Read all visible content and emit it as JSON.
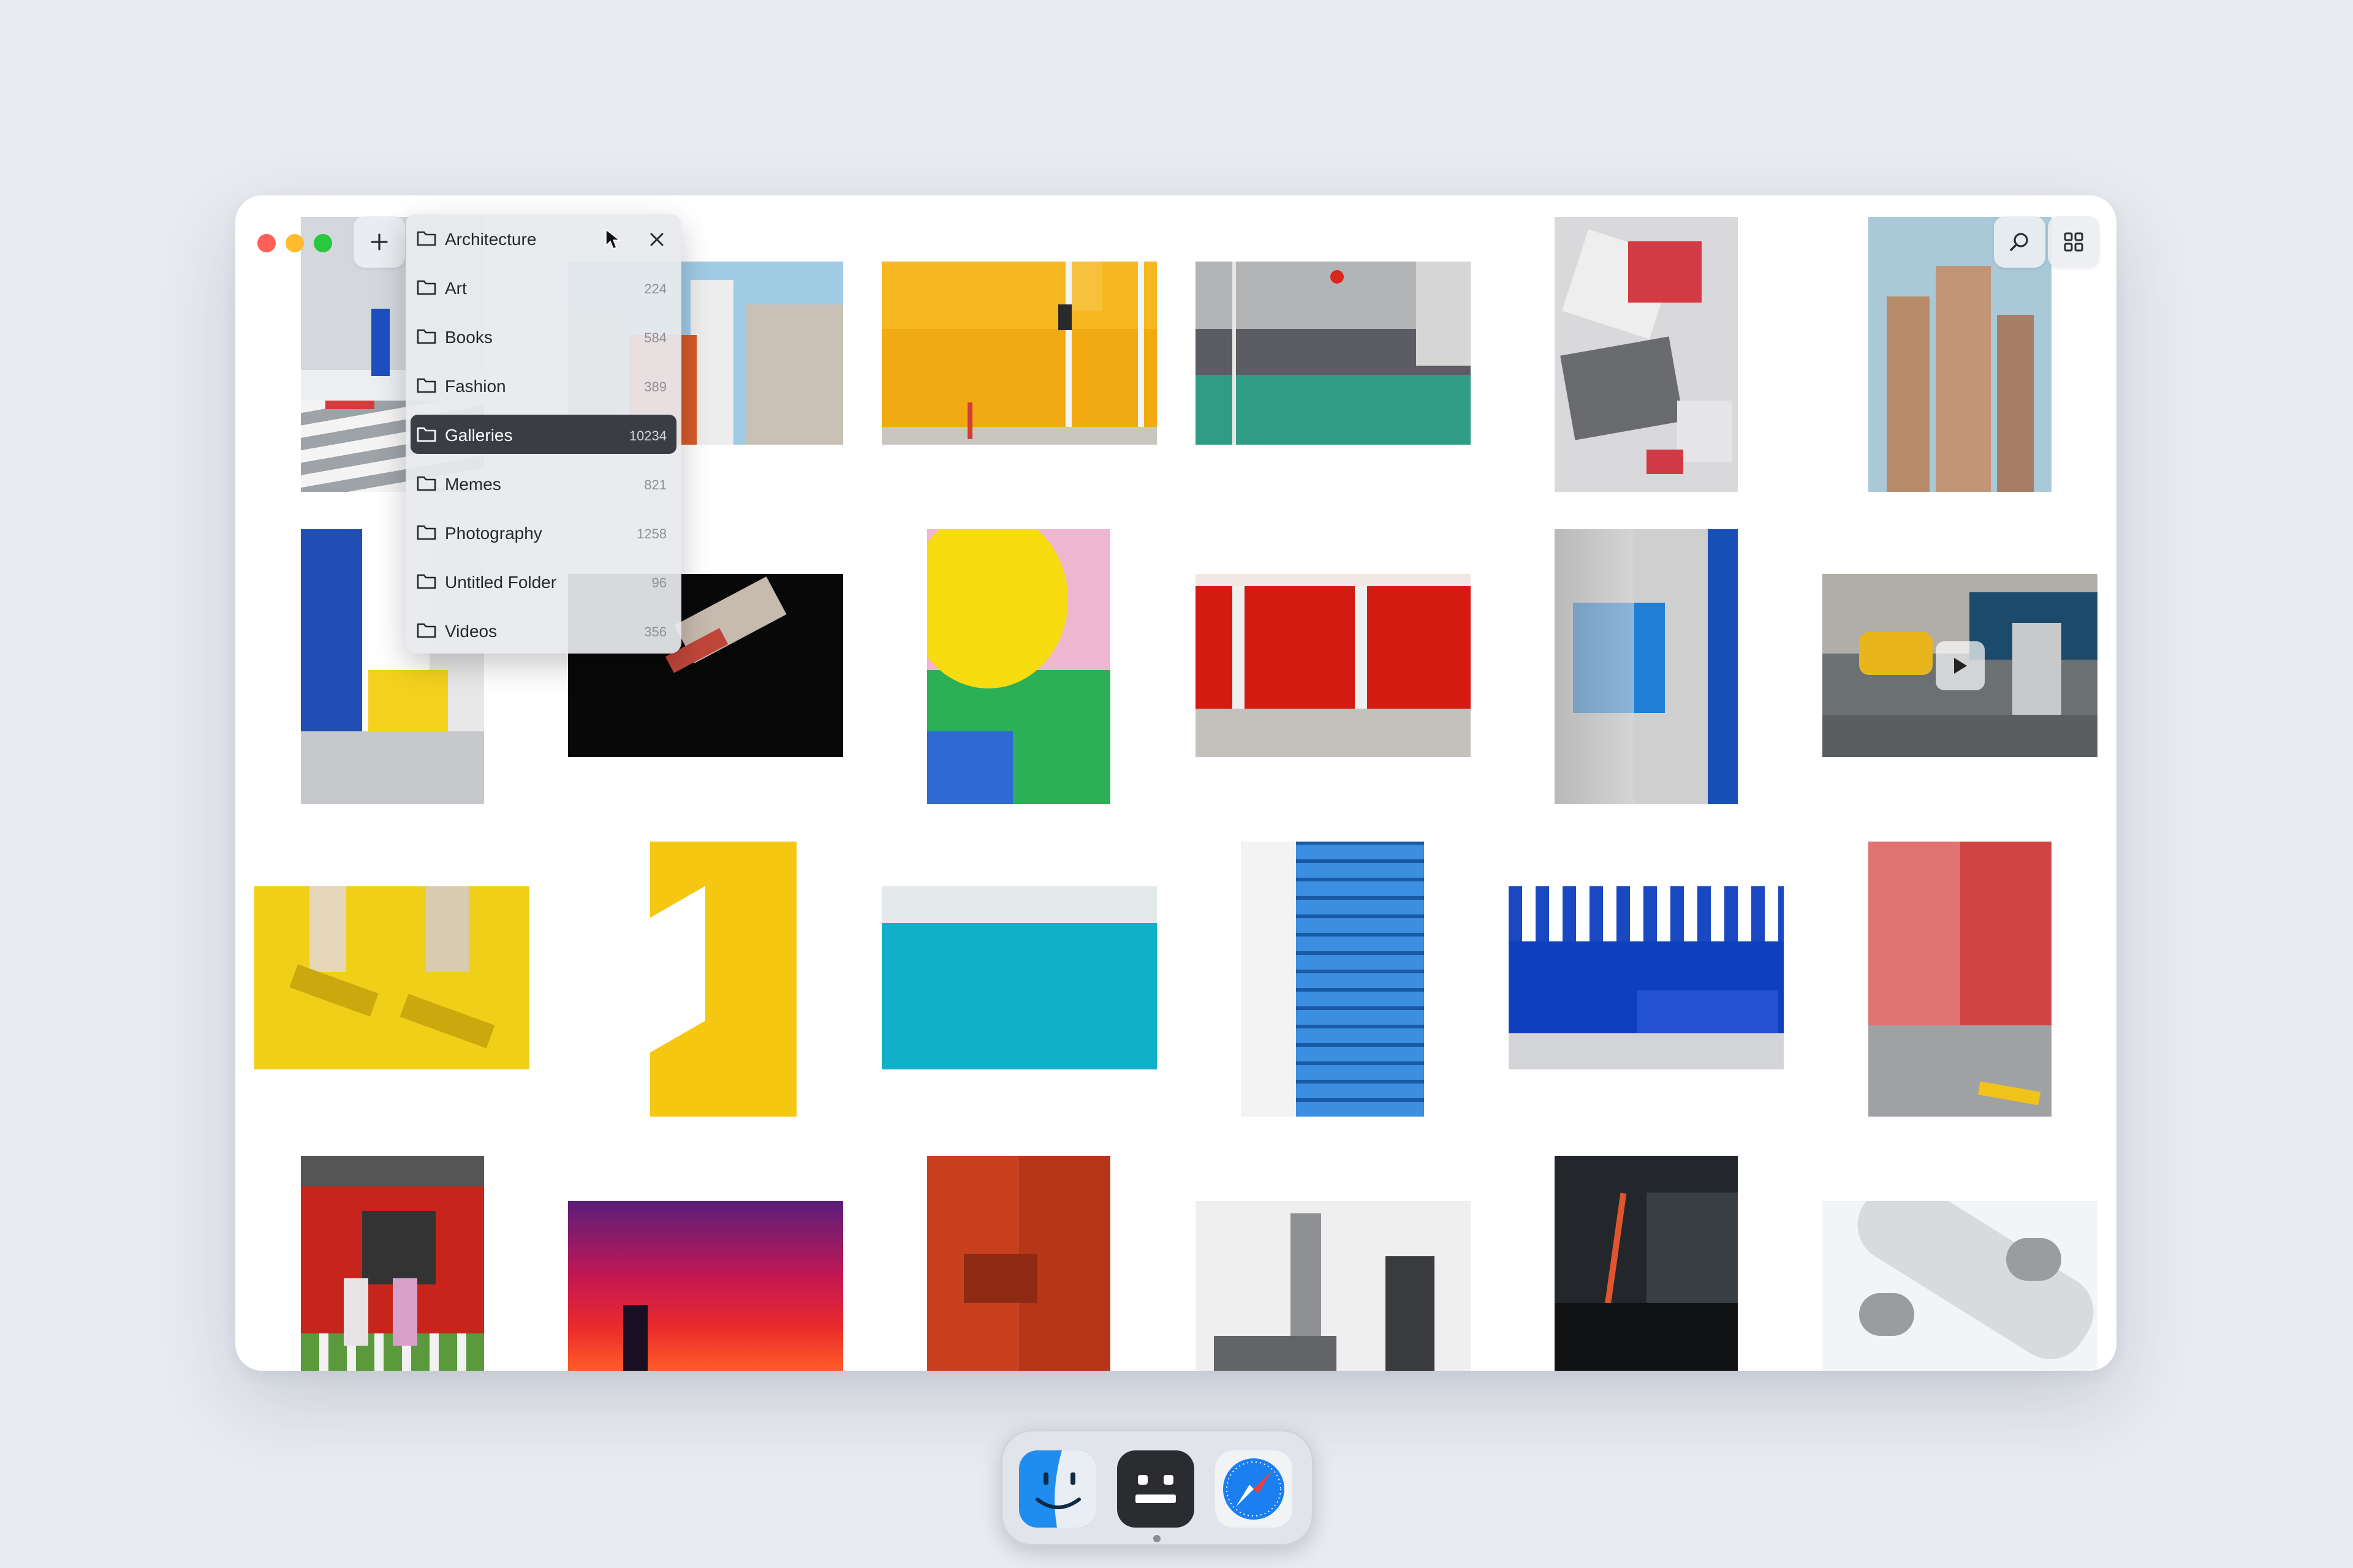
{
  "window": {
    "toolbar": {
      "add_label": "Add",
      "search_label": "Search",
      "grid_label": "Grid view"
    },
    "dropdown": {
      "title": "Architecture",
      "items": [
        {
          "label": "Art",
          "count": "224"
        },
        {
          "label": "Books",
          "count": "584"
        },
        {
          "label": "Fashion",
          "count": "389"
        },
        {
          "label": "Galleries",
          "count": "10234"
        },
        {
          "label": "Memes",
          "count": "821"
        },
        {
          "label": "Photography",
          "count": "1258"
        },
        {
          "label": "Untitled Folder",
          "count": "96"
        },
        {
          "label": "Videos",
          "count": "356"
        }
      ],
      "selected": "Galleries"
    }
  },
  "gallery": {
    "rows": [
      [
        "white-building-crosswalk",
        "apartment-buildings",
        "yellow-wall-traffic-light",
        "road-markings",
        "robot-armor-closeup",
        "tall-brown-towers"
      ],
      [
        "blue-yellow-building",
        "dark-stair-shadow",
        "yellow-umbrella",
        "red-doors",
        "concrete-blue-tarp",
        "street-walker-video"
      ],
      [
        "yellow-ground-walkers",
        "yellow-building-corner",
        "turquoise-pool",
        "blue-tower",
        "blue-white-awning",
        "red-building-parking"
      ],
      [
        "temple-kimono",
        "red-sunset",
        "orange-building-stairs",
        "grey-skyscrapers",
        "dark-building-ladder",
        "airplane-underside"
      ]
    ]
  },
  "dock": {
    "apps": [
      {
        "name": "Finder",
        "icon": "finder-icon"
      },
      {
        "name": "Robot",
        "icon": "robot-icon"
      },
      {
        "name": "Safari",
        "icon": "compass-icon"
      }
    ]
  }
}
